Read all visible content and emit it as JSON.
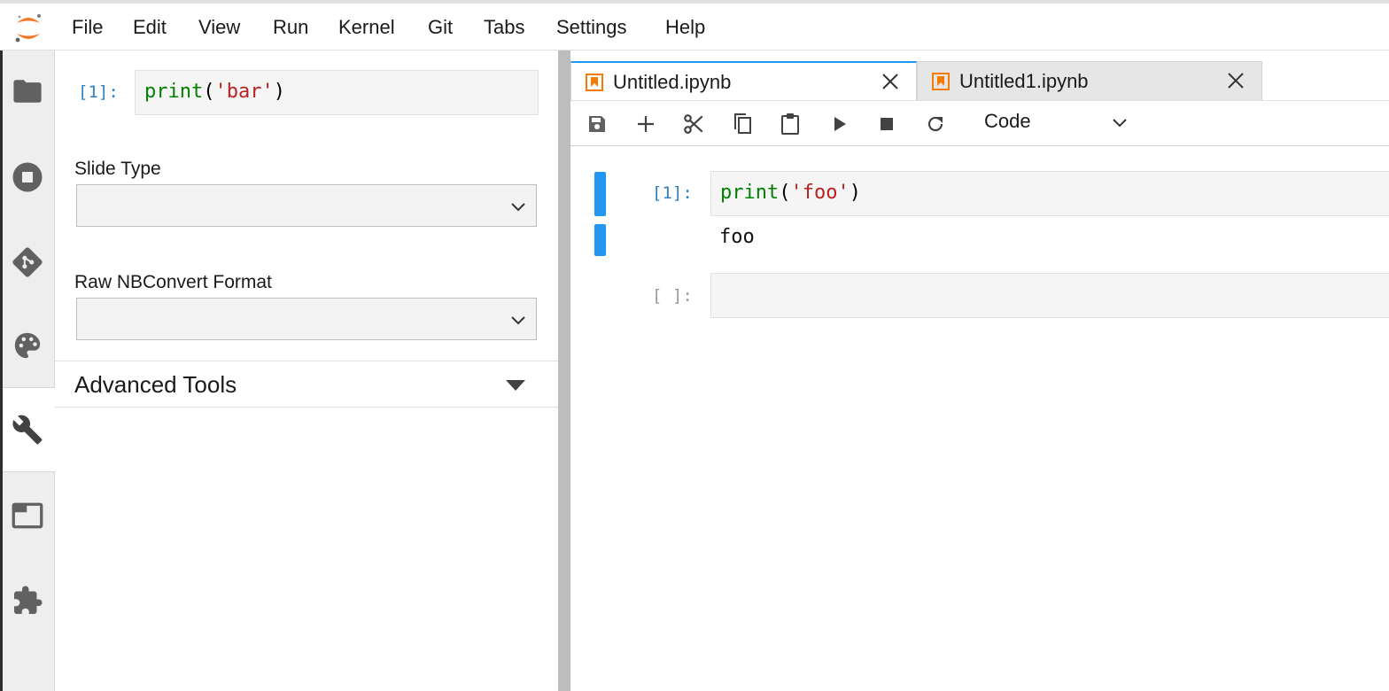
{
  "menubar": {
    "items": [
      "File",
      "Edit",
      "View",
      "Run",
      "Kernel",
      "Git",
      "Tabs",
      "Settings",
      "Help"
    ]
  },
  "left_sidebar": {
    "icons": [
      "folder-icon",
      "stop-circle-icon",
      "git-icon",
      "palette-icon",
      "wrench-icon",
      "tabs-icon",
      "extension-icon"
    ],
    "active": "wrench-icon"
  },
  "property_inspector": {
    "cell": {
      "prompt": "[1]:",
      "code_fn": "print",
      "code_open": "(",
      "code_str": "'bar'",
      "code_close": ")"
    },
    "slide_type": {
      "label": "Slide Type",
      "value": ""
    },
    "raw_format": {
      "label": "Raw NBConvert Format",
      "value": ""
    },
    "advanced": {
      "label": "Advanced Tools"
    }
  },
  "tabs": [
    {
      "label": "Untitled.ipynb",
      "active": true
    },
    {
      "label": "Untitled1.ipynb",
      "active": false
    }
  ],
  "toolbar": {
    "buttons": [
      "save-icon",
      "add-icon",
      "cut-icon",
      "copy-icon",
      "paste-icon",
      "run-icon",
      "stop-icon",
      "restart-icon"
    ],
    "cell_type": "Code"
  },
  "notebook": {
    "cells": [
      {
        "prompt": "[1]:",
        "code_fn": "print",
        "code_open": "(",
        "code_str": "'foo'",
        "code_close": ")",
        "output": "foo"
      },
      {
        "prompt": "[ ]:",
        "code": ""
      }
    ]
  },
  "colors": {
    "accent": "#2196f3",
    "logo": "#f37726",
    "prompt": "#307fc1",
    "keyword": "#008000",
    "string": "#ba2121"
  }
}
